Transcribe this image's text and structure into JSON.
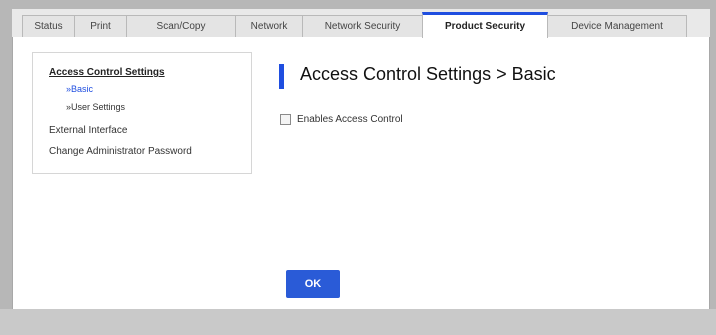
{
  "tabs": [
    {
      "label": "Status"
    },
    {
      "label": "Print"
    },
    {
      "label": "Scan/Copy"
    },
    {
      "label": "Network"
    },
    {
      "label": "Network Security"
    },
    {
      "label": "Product Security"
    },
    {
      "label": "Device Management"
    }
  ],
  "active_tab": "Product Security",
  "sidebar": {
    "items": [
      {
        "label": "Access Control Settings"
      },
      {
        "label": "»Basic"
      },
      {
        "label": "»User Settings"
      },
      {
        "label": "External Interface"
      },
      {
        "label": "Change Administrator Password"
      }
    ]
  },
  "main": {
    "title": "Access Control Settings > Basic",
    "checkbox_label": "Enables Access Control",
    "checkbox_checked": false,
    "ok_label": "OK"
  },
  "colors": {
    "accent": "#1f4ee0",
    "ok_button": "#2a5bd7"
  }
}
